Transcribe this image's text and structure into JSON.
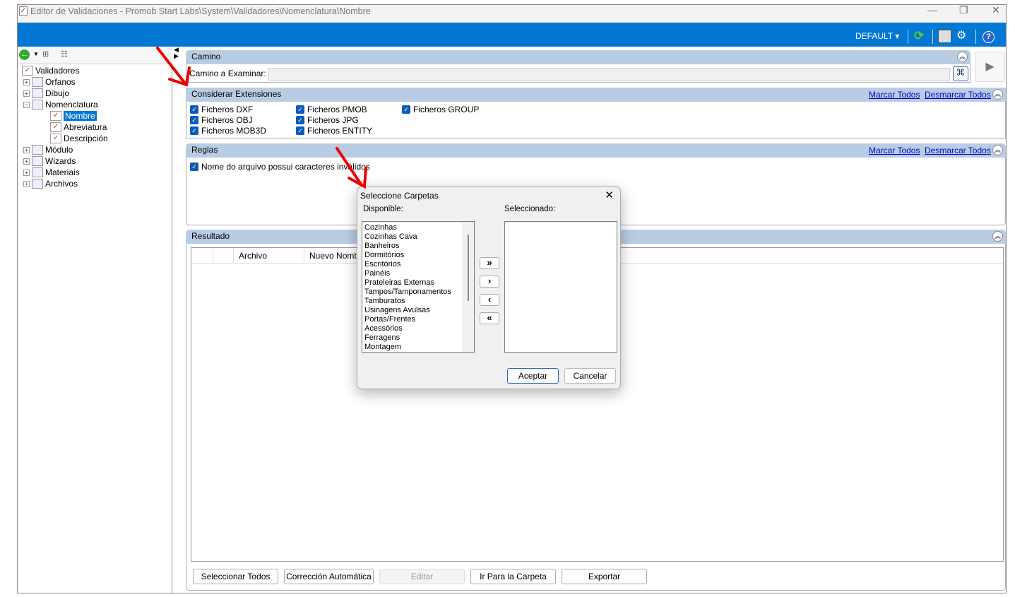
{
  "window": {
    "title": "Editor de Validaciones - Promob Start Labs\\System\\Validadores\\Nomenclatura\\Nombre",
    "minimize": "—",
    "restore": "❐",
    "close": "✕"
  },
  "toolbar": {
    "profile": "DEFAULT ▾",
    "icons": [
      "refresh-icon",
      "layout-icon",
      "settings-icon",
      "help-icon"
    ]
  },
  "tree": {
    "root": "Validadores",
    "items": [
      {
        "label": "Orfanos",
        "expanded": false
      },
      {
        "label": "Dibujo",
        "expanded": false
      },
      {
        "label": "Nomenclatura",
        "expanded": true
      },
      {
        "label": "Nombre",
        "child": true,
        "selected": true
      },
      {
        "label": "Abreviatura",
        "child": true
      },
      {
        "label": "Descripción",
        "child": true
      },
      {
        "label": "Módulo",
        "expanded": false
      },
      {
        "label": "Wizards",
        "expanded": false
      },
      {
        "label": "Materiais",
        "expanded": false
      },
      {
        "label": "Archivos",
        "expanded": false
      }
    ]
  },
  "camino": {
    "header": "Camino",
    "label": "Camino a Examinar:",
    "value": ""
  },
  "extensiones": {
    "header": "Considerar Extensiones",
    "mark_all": "Marcar Todos",
    "unmark_all": "Desmarcar Todos",
    "items": [
      "Ficheros DXF",
      "Ficheros OBJ",
      "Ficheros MOB3D",
      "Ficheros PMOB",
      "Ficheros JPG",
      "Ficheros ENTITY",
      "Ficheros GROUP"
    ]
  },
  "reglas": {
    "header": "Reglas",
    "mark_all": "Marcar Todos",
    "unmark_all": "Desmarcar Todos",
    "items": [
      "Nome do arquivo possui caracteres inválidos"
    ]
  },
  "resultado": {
    "header": "Resultado",
    "columns": [
      "",
      "",
      "Archivo",
      "Nuevo Nombre"
    ]
  },
  "buttons": {
    "select_all": "Seleccionar Todos",
    "auto_fix": "Corrección Automática",
    "edit": "Editar",
    "go_folder": "Ir Para la Carpeta",
    "export": "Exportar"
  },
  "dialog": {
    "title": "Seleccione Carpetas",
    "available_label": "Disponible:",
    "selected_label": "Seleccionado:",
    "available": [
      "Cozinhas",
      "Cozinhas Cava",
      "Banheiros",
      "Dormitórios",
      "Escritórios",
      "Painéis",
      "Prateleiras Externas",
      "Tampos/Tamponamentos",
      "Tamburatos",
      "Usinagens Avulsas",
      "Portas/Frentes",
      "Acessórios",
      "Ferragens",
      "Montagem"
    ],
    "selected": [],
    "add_all": "»",
    "add": "›",
    "remove": "‹",
    "remove_all": "«",
    "ok": "Aceptar",
    "cancel": "Cancelar"
  }
}
